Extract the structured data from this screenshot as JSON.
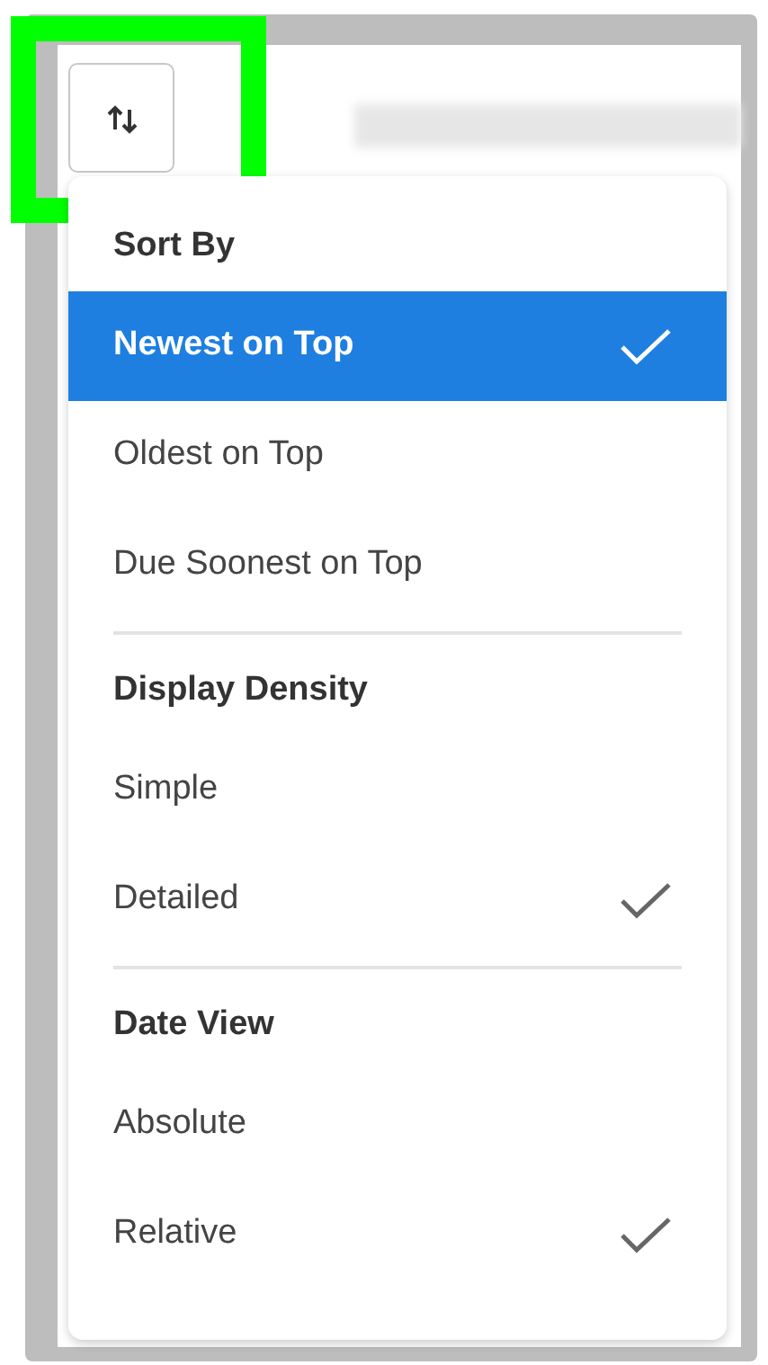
{
  "sort_button": {
    "highlighted": true
  },
  "menu": {
    "sections": [
      {
        "header": "Sort By",
        "items": [
          {
            "label": "Newest on Top",
            "selected": true,
            "checked": true
          },
          {
            "label": "Oldest on Top",
            "selected": false,
            "checked": false
          },
          {
            "label": "Due Soonest on Top",
            "selected": false,
            "checked": false
          }
        ]
      },
      {
        "header": "Display Density",
        "items": [
          {
            "label": "Simple",
            "selected": false,
            "checked": false
          },
          {
            "label": "Detailed",
            "selected": false,
            "checked": true
          }
        ]
      },
      {
        "header": "Date View",
        "items": [
          {
            "label": "Absolute",
            "selected": false,
            "checked": false
          },
          {
            "label": "Relative",
            "selected": false,
            "checked": true
          }
        ]
      }
    ]
  }
}
